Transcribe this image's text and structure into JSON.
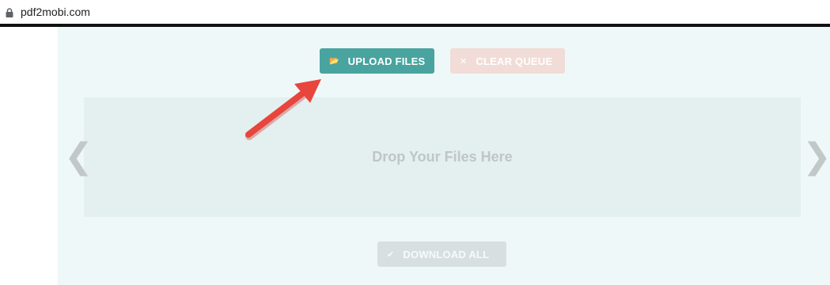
{
  "browser": {
    "url": "pdf2mobi.com",
    "lock_icon": "lock-icon"
  },
  "toolbar": {
    "upload_icon": "folder-open-icon",
    "upload_label": "UPLOAD FILES",
    "clear_icon": "close-icon",
    "clear_label": "CLEAR QUEUE"
  },
  "dropzone": {
    "label": "Drop Your Files Here"
  },
  "nav": {
    "prev_icon": "chevron-left-icon",
    "prev_glyph": "❮",
    "next_icon": "chevron-right-icon",
    "next_glyph": "❯"
  },
  "footer": {
    "download_icon": "check-icon",
    "download_label": "DOWNLOAD ALL"
  },
  "colors": {
    "upload_button": "#49a4a0",
    "clear_button": "#f2dcd7",
    "download_button": "#d7dfdf",
    "panel_background": "#eff8f8",
    "annotation_arrow": "#e8453c"
  }
}
